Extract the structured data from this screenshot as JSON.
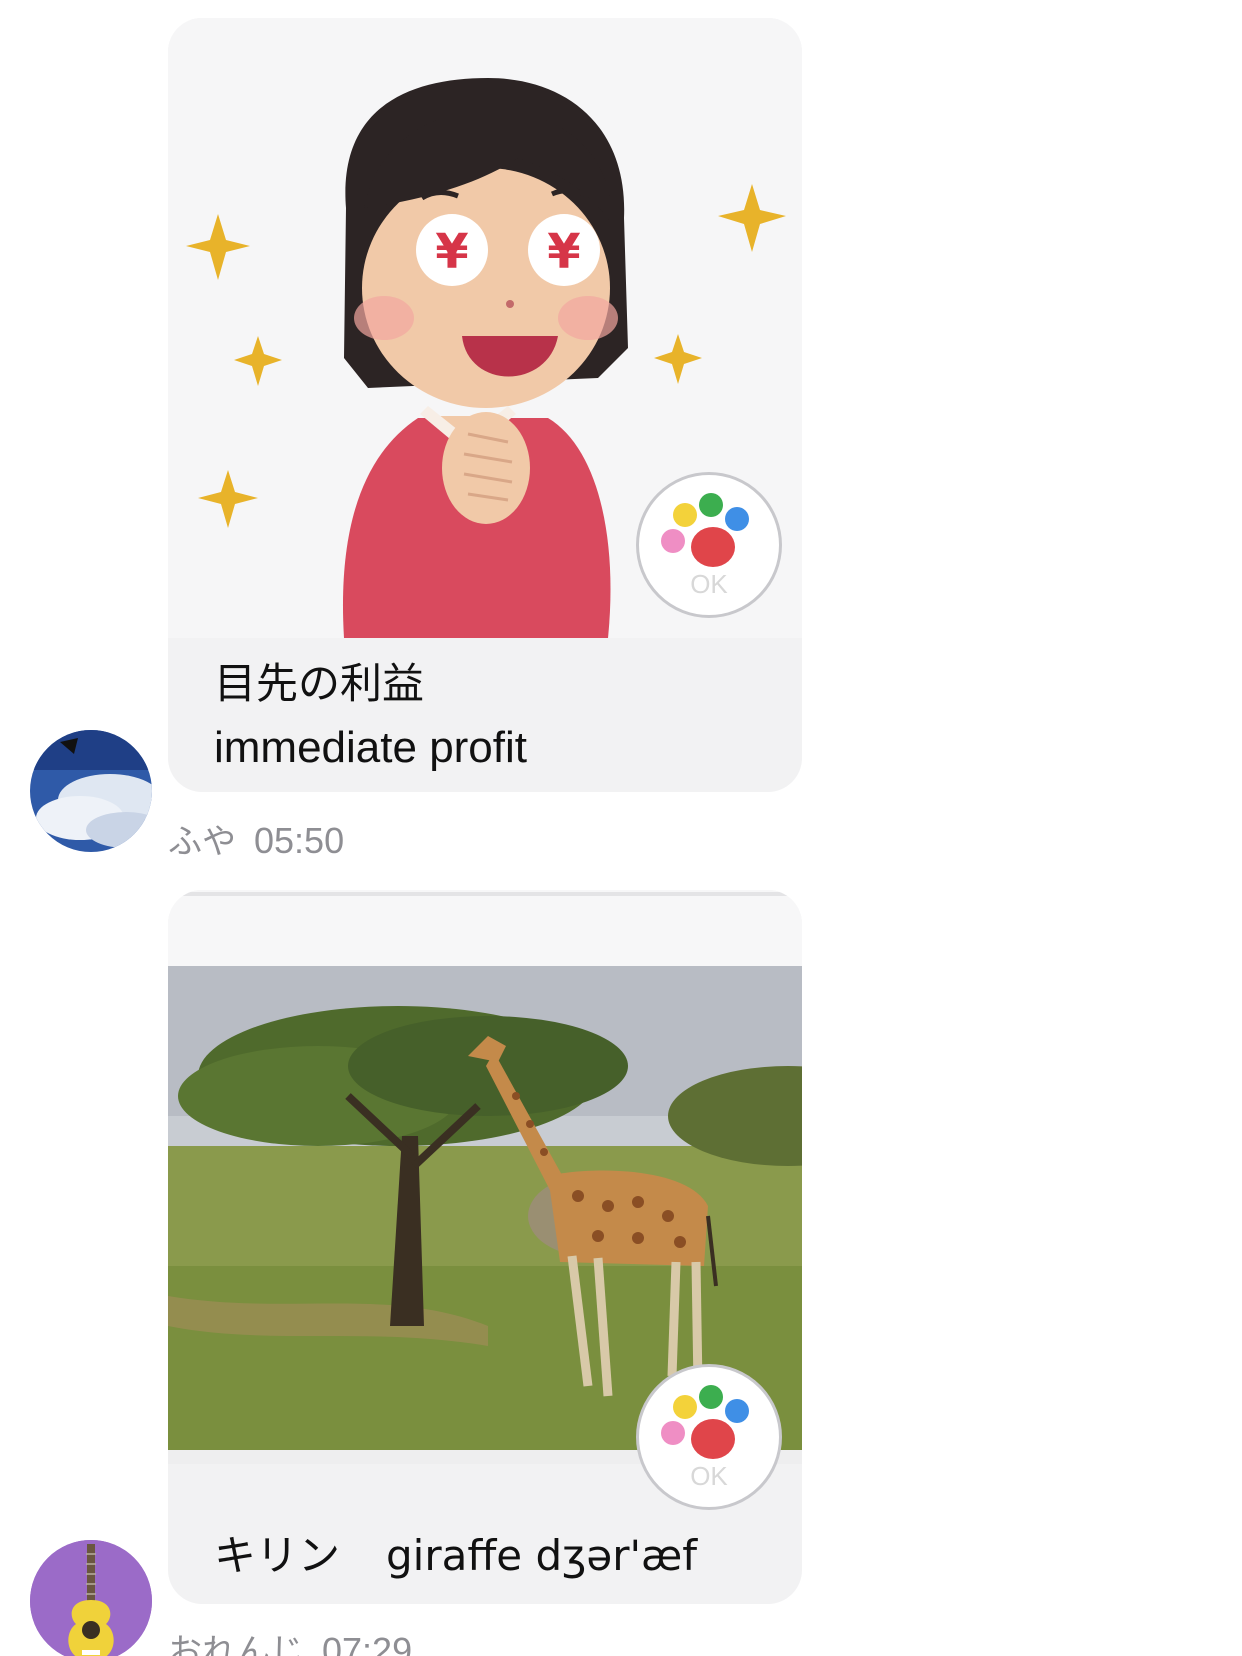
{
  "messages": [
    {
      "caption_line1": "目先の利益",
      "caption_line2": "immediate profit",
      "image_icon": "woman-yen-eyes-illustration",
      "reaction": "OK",
      "sender": "ふや",
      "time": "05:50"
    },
    {
      "caption_jp": "キリン",
      "caption_en": "giraffe dʒər'æf",
      "image_icon": "giraffe-savanna-photo",
      "reaction": "OK",
      "sender": "おれんじ",
      "time": "07:29"
    }
  ],
  "avatars": [
    {
      "icon": "sky-clouds-avatar"
    },
    {
      "icon": "guitar-avatar",
      "color": "#9b6bc8"
    }
  ],
  "colors": {
    "bubble": "#f2f2f3",
    "meta_text": "#8e8e93",
    "paw_yellow": "#f3d23a",
    "paw_green": "#3cae4f",
    "paw_blue": "#3f8fe6",
    "paw_pink": "#ef8ec4",
    "paw_red": "#e0454a"
  }
}
